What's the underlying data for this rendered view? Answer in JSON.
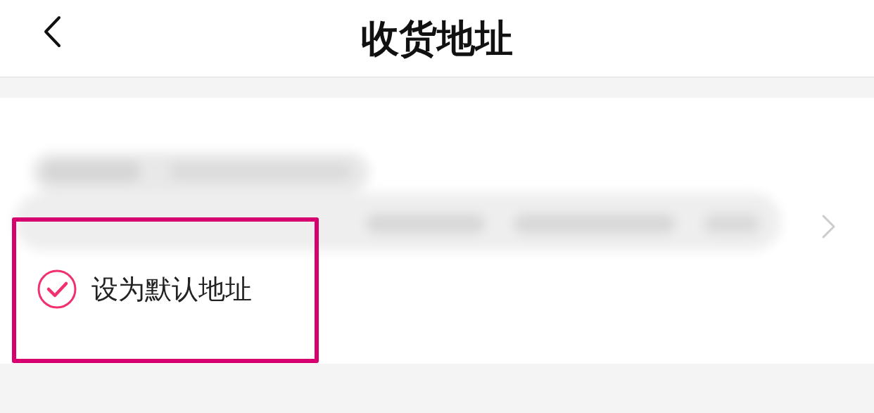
{
  "header": {
    "title": "收货地址"
  },
  "address": {
    "kind": "blurred"
  },
  "default_option": {
    "label": "设为默认地址",
    "checked": true
  },
  "annotation": {
    "kind": "highlight-frame"
  }
}
